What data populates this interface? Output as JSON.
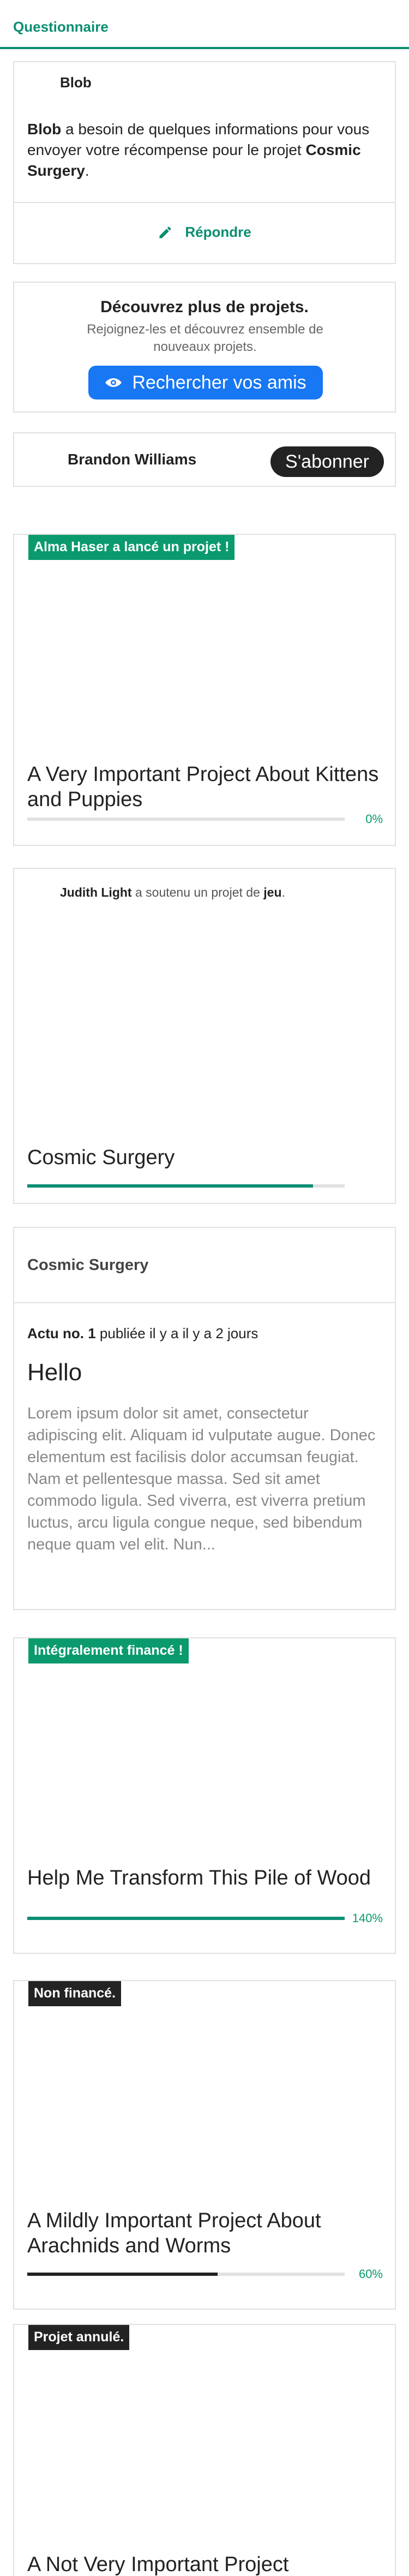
{
  "tabs": {
    "active": "Questionnaire"
  },
  "questionnaire_card": {
    "author": "Blob",
    "message_author": "Blob",
    "message_text": " a besoin de quelques informations pour vous envoyer votre récompense pour le projet ",
    "message_project": "Cosmic Surgery",
    "message_end": ".",
    "reply_label": "Répondre"
  },
  "discover_card": {
    "title": "Découvrez plus de projets.",
    "subtitle": "Rejoignez-les et découvrez ensemble de nouveaux projets.",
    "button_label": "Rechercher vos amis"
  },
  "follow_card": {
    "name": "Brandon Williams",
    "button_label": "S'abonner"
  },
  "projects": [
    {
      "badge": "Alma Haser a lancé un projet !",
      "title": "A Very Important Project About Kittens and Puppies",
      "percent_label": "0%",
      "progress": 0
    },
    {
      "badge": "Intégralement financé !",
      "title": "Help Me Transform This Pile of Wood",
      "percent_label": "140%",
      "progress": 1.0
    },
    {
      "badge": "Non financé.",
      "title": "A Mildly Important Project About Arachnids and Worms",
      "percent_label": "60%",
      "progress": 0.6
    },
    {
      "badge": "Projet annulé.",
      "title": "A Not Very Important Project"
    }
  ],
  "backed_card": {
    "backer": "Judith Light",
    "activity_text": " a soutenu un projet de ",
    "category": "jeu",
    "activity_end": ".",
    "project_title": "Cosmic Surgery",
    "progress": 0.9
  },
  "update_card": {
    "project_name": "Cosmic Surgery",
    "update_number": "Actu no. 1",
    "update_meta": " publiée il y a il y a 2 jours",
    "update_title": "Hello",
    "update_body": "Lorem ipsum dolor sit amet, consectetur adipiscing elit. Aliquam id vulputate augue. Donec elementum est facilisis dolor accumsan feugiat. Nam et pellentesque massa. Sed sit amet commodo ligula. Sed viverra, est viverra pretium luctus, arcu ligula congue neque, sed bibendum neque quam vel elit. Nun..."
  },
  "colors": {
    "accent": "#0b8e72",
    "green_badge": "#0a9a6d",
    "dark": "#232323",
    "facebook_blue": "#1877f2"
  },
  "icons": {
    "reply": "pencil-icon",
    "friends": "eye-icon"
  }
}
